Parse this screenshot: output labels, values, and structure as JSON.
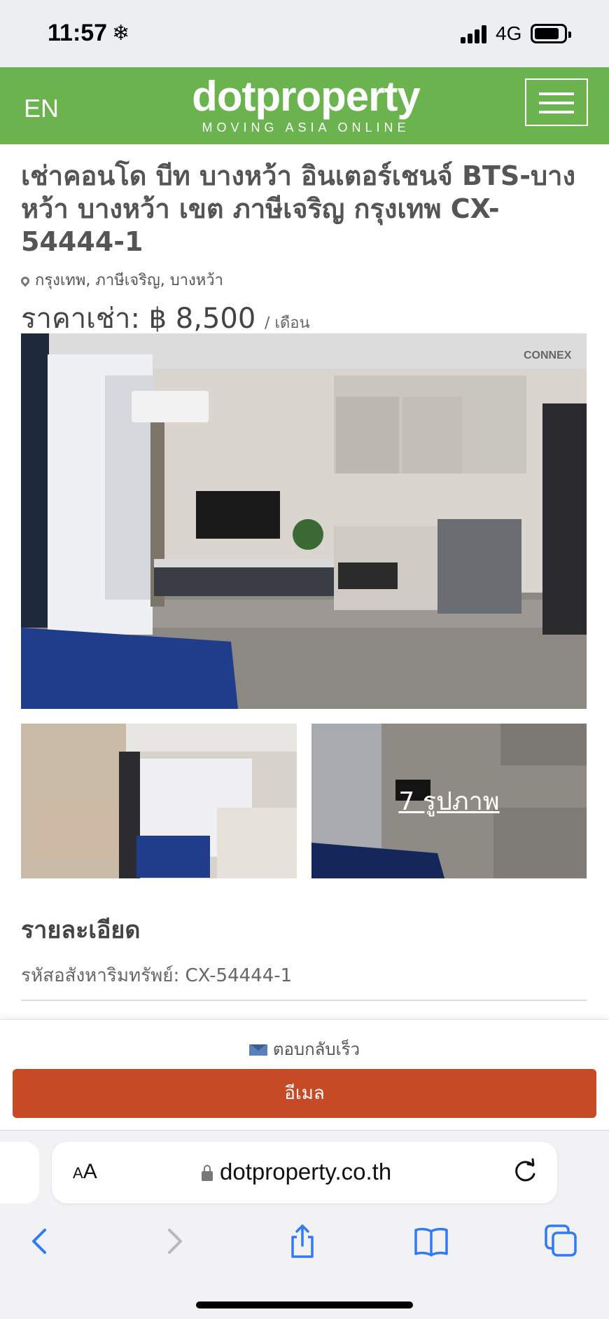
{
  "status_bar": {
    "time": "11:57",
    "time_icon": "snowflake-icon",
    "network": "4G"
  },
  "header": {
    "language": "EN",
    "logo_text": "dotproperty",
    "logo_tagline": "MOVING ASIA ONLINE",
    "brand_color": "#6ab34f",
    "menu_icon": "hamburger-menu-icon"
  },
  "listing": {
    "title": "เช่าคอนโด บีท บางหว้า อินเตอร์เชนจ์ BTS-บางหว้า บางหว้า เขต ภาษีเจริญ กรุงเทพ CX-54444-1",
    "location": "กรุงเทพ, ภาษีเจริญ, บางหว้า",
    "price_label": "ราคาเช่า:",
    "price": "฿ 8,500",
    "price_period": "/ เดือน",
    "photo_count": "7 รูปภาพ",
    "watermark": "CONNEX"
  },
  "details": {
    "section_title": "รายละเอียด",
    "property_code": "รหัสอสังหาริมทรัพย์: CX-54444-1"
  },
  "contact": {
    "quick_reply": "ตอบกลับเร็ว",
    "email_button": "อีเมล",
    "button_color": "#c74a26"
  },
  "browser": {
    "text_size_label": "AA",
    "url": "dotproperty.co.th",
    "toolbar_icons": [
      "back-icon",
      "forward-icon",
      "share-icon",
      "bookmarks-icon",
      "tabs-icon"
    ],
    "accent_color": "#2f7bf6"
  }
}
